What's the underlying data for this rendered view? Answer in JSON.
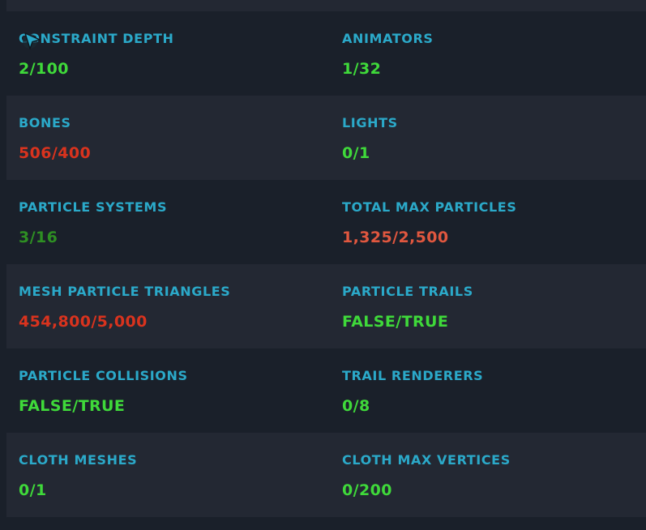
{
  "colors": {
    "ok": "#3fd93a",
    "ok_dim": "#2e8f23",
    "over": "#d9331e",
    "warn": "#e0573f",
    "label": "#2ba9c9"
  },
  "stats": {
    "constraint_depth": {
      "label": "CONSTRAINT DEPTH",
      "value": "2/100",
      "status": "ok"
    },
    "animators": {
      "label": "ANIMATORS",
      "value": "1/32",
      "status": "ok"
    },
    "bones": {
      "label": "BONES",
      "value": "506/400",
      "status": "over"
    },
    "lights": {
      "label": "LIGHTS",
      "value": "0/1",
      "status": "ok"
    },
    "particle_systems": {
      "label": "PARTICLE SYSTEMS",
      "value": "3/16",
      "status": "ok_dim"
    },
    "total_max_particles": {
      "label": "TOTAL MAX PARTICLES",
      "value": "1,325/2,500",
      "status": "warn"
    },
    "mesh_particle_triangles": {
      "label": "MESH PARTICLE TRIANGLES",
      "value": "454,800/5,000",
      "status": "over"
    },
    "particle_trails": {
      "label": "PARTICLE TRAILS",
      "value": "FALSE/TRUE",
      "status": "ok"
    },
    "particle_collisions": {
      "label": "PARTICLE COLLISIONS",
      "value": "FALSE/TRUE",
      "status": "ok"
    },
    "trail_renderers": {
      "label": "TRAIL RENDERERS",
      "value": "0/8",
      "status": "ok"
    },
    "cloth_meshes": {
      "label": "CLOTH MESHES",
      "value": "0/1",
      "status": "ok"
    },
    "cloth_max_vertices": {
      "label": "CLOTH MAX VERTICES",
      "value": "0/200",
      "status": "ok"
    }
  },
  "cursor": {
    "icon": "mouse-pointer-icon"
  }
}
